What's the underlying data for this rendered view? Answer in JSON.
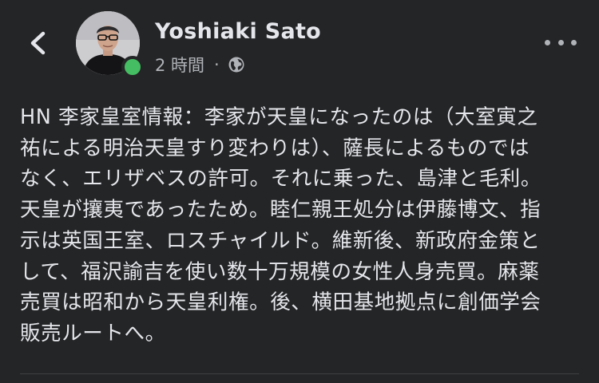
{
  "post": {
    "author": "Yoshiaki Sato",
    "time_ago": "2 時間",
    "separator": "·",
    "audience_icon": "globe-icon",
    "online": true,
    "lines": [
      "HN 李家皇室情報：李家が天皇になったのは（大室寅之",
      "祐による明治天皇すり変わりは）、薩長によるものでは",
      "なく、エリザベスの許可。それに乗った、島津と毛利。",
      "天皇が攘夷であったため。睦仁親王処分は伊藤博文、指",
      "示は英国王室、ロスチャイルド。維新後、新政府金策と",
      "して、福沢諭吉を使い数十万規模の女性人身売買。麻薬",
      "売買は昭和から天皇利権。後、横田基地拠点に創価学会",
      "販売ルートへ。"
    ]
  },
  "header": {
    "back_icon": "chevron-left-icon",
    "more_icon": "more-horizontal-icon"
  },
  "colors": {
    "background": "#242526",
    "text_primary": "#e4e6eb",
    "text_secondary": "#b0b3b8",
    "online_green": "#45bd62"
  }
}
